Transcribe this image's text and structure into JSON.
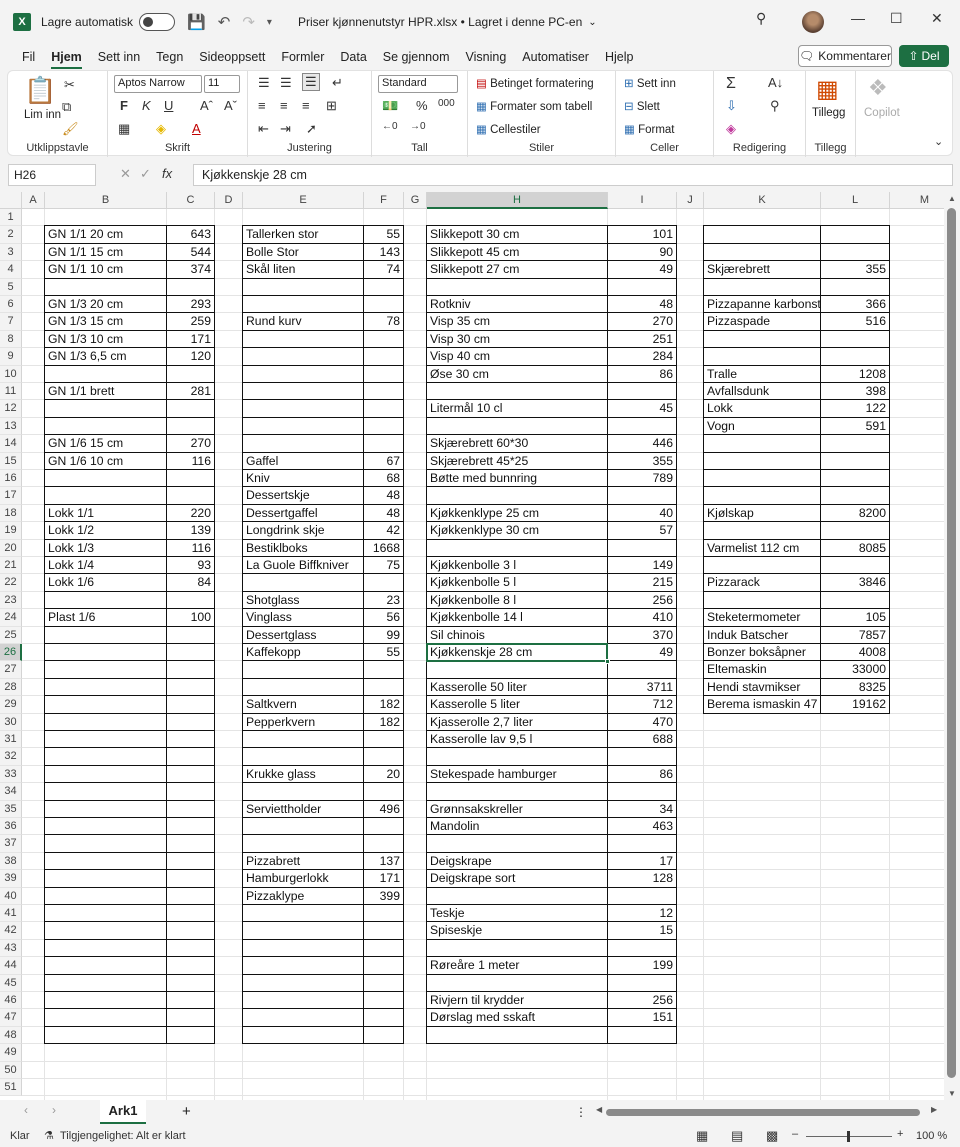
{
  "titlebar": {
    "autosave_label": "Lagre automatisk",
    "file_title": "Priser kjønnenutstyr HPR.xlsx • Lagret i denne PC-en"
  },
  "menu": [
    "Fil",
    "Hjem",
    "Sett inn",
    "Tegn",
    "Sideoppsett",
    "Formler",
    "Data",
    "Se gjennom",
    "Visning",
    "Automatiser",
    "Hjelp"
  ],
  "menu_active": "Hjem",
  "comment_button": "Kommentarer",
  "share_button": "Del",
  "ribbon": {
    "paste": "Lim inn",
    "clipboard": "Utklippstavle",
    "font_name": "Aptos Narrow",
    "font_size": "11",
    "font": "Skrift",
    "alignment": "Justering",
    "number_format": "Standard",
    "number": "Tall",
    "cond_format": "Betinget formatering",
    "format_table": "Formater som tabell",
    "cell_styles": "Cellestiler",
    "styles": "Stiler",
    "insert": "Sett inn",
    "delete": "Slett",
    "format": "Format",
    "cells": "Celler",
    "editing": "Redigering",
    "addins": "Tillegg",
    "addins_group": "Tillegg",
    "copilot": "Copilot"
  },
  "name_box": "H26",
  "formula": "Kjøkkenskje  28 cm",
  "columns": [
    "A",
    "B",
    "C",
    "D",
    "E",
    "F",
    "G",
    "H",
    "I",
    "J",
    "K",
    "L",
    "M"
  ],
  "rows": [
    "1",
    "2",
    "3",
    "4",
    "5",
    "6",
    "7",
    "8",
    "9",
    "10",
    "11",
    "12",
    "13",
    "14",
    "15",
    "16",
    "17",
    "18",
    "19",
    "20",
    "21",
    "22",
    "23",
    "24",
    "25",
    "26",
    "27",
    "28",
    "29",
    "30",
    "31",
    "32",
    "33",
    "34",
    "35",
    "36",
    "37",
    "38",
    "39",
    "40",
    "41",
    "42",
    "43",
    "44",
    "45",
    "46",
    "47",
    "48",
    "49",
    "50",
    "51"
  ],
  "cells": [
    {
      "r": 2,
      "c": "B",
      "v": "GN 1/1 20 cm"
    },
    {
      "r": 2,
      "c": "C",
      "v": "643"
    },
    {
      "r": 3,
      "c": "B",
      "v": "GN 1/1 15 cm"
    },
    {
      "r": 3,
      "c": "C",
      "v": "544"
    },
    {
      "r": 4,
      "c": "B",
      "v": "GN 1/1 10 cm"
    },
    {
      "r": 4,
      "c": "C",
      "v": "374"
    },
    {
      "r": 6,
      "c": "B",
      "v": "GN 1/3 20 cm"
    },
    {
      "r": 6,
      "c": "C",
      "v": "293"
    },
    {
      "r": 7,
      "c": "B",
      "v": "GN 1/3 15 cm"
    },
    {
      "r": 7,
      "c": "C",
      "v": "259"
    },
    {
      "r": 8,
      "c": "B",
      "v": "GN 1/3 10 cm"
    },
    {
      "r": 8,
      "c": "C",
      "v": "171"
    },
    {
      "r": 9,
      "c": "B",
      "v": "GN 1/3 6,5 cm"
    },
    {
      "r": 9,
      "c": "C",
      "v": "120"
    },
    {
      "r": 11,
      "c": "B",
      "v": "GN 1/1 brett"
    },
    {
      "r": 11,
      "c": "C",
      "v": "281"
    },
    {
      "r": 14,
      "c": "B",
      "v": "GN 1/6 15 cm"
    },
    {
      "r": 14,
      "c": "C",
      "v": "270"
    },
    {
      "r": 15,
      "c": "B",
      "v": "GN 1/6 10 cm"
    },
    {
      "r": 15,
      "c": "C",
      "v": "116"
    },
    {
      "r": 18,
      "c": "B",
      "v": "Lokk 1/1"
    },
    {
      "r": 18,
      "c": "C",
      "v": "220"
    },
    {
      "r": 19,
      "c": "B",
      "v": "Lokk 1/2"
    },
    {
      "r": 19,
      "c": "C",
      "v": "139"
    },
    {
      "r": 20,
      "c": "B",
      "v": "Lokk 1/3"
    },
    {
      "r": 20,
      "c": "C",
      "v": "116"
    },
    {
      "r": 21,
      "c": "B",
      "v": "Lokk 1/4"
    },
    {
      "r": 21,
      "c": "C",
      "v": "93"
    },
    {
      "r": 22,
      "c": "B",
      "v": "Lokk 1/6"
    },
    {
      "r": 22,
      "c": "C",
      "v": "84"
    },
    {
      "r": 24,
      "c": "B",
      "v": "Plast 1/6"
    },
    {
      "r": 24,
      "c": "C",
      "v": "100"
    },
    {
      "r": 2,
      "c": "E",
      "v": "Tallerken stor"
    },
    {
      "r": 2,
      "c": "F",
      "v": "55"
    },
    {
      "r": 3,
      "c": "E",
      "v": "Bolle Stor"
    },
    {
      "r": 3,
      "c": "F",
      "v": "143"
    },
    {
      "r": 4,
      "c": "E",
      "v": "Skål liten"
    },
    {
      "r": 4,
      "c": "F",
      "v": "74"
    },
    {
      "r": 7,
      "c": "E",
      "v": "Rund kurv"
    },
    {
      "r": 7,
      "c": "F",
      "v": "78"
    },
    {
      "r": 15,
      "c": "E",
      "v": "Gaffel"
    },
    {
      "r": 15,
      "c": "F",
      "v": "67"
    },
    {
      "r": 16,
      "c": "E",
      "v": "Kniv"
    },
    {
      "r": 16,
      "c": "F",
      "v": "68"
    },
    {
      "r": 17,
      "c": "E",
      "v": "Dessertskje"
    },
    {
      "r": 17,
      "c": "F",
      "v": "48"
    },
    {
      "r": 18,
      "c": "E",
      "v": "Dessertgaffel"
    },
    {
      "r": 18,
      "c": "F",
      "v": "48"
    },
    {
      "r": 19,
      "c": "E",
      "v": "Longdrink skje"
    },
    {
      "r": 19,
      "c": "F",
      "v": "42"
    },
    {
      "r": 20,
      "c": "E",
      "v": "Bestiklboks"
    },
    {
      "r": 20,
      "c": "F",
      "v": "1668"
    },
    {
      "r": 21,
      "c": "E",
      "v": "La Guole Biffkniver"
    },
    {
      "r": 21,
      "c": "F",
      "v": "75"
    },
    {
      "r": 23,
      "c": "E",
      "v": "Shotglass"
    },
    {
      "r": 23,
      "c": "F",
      "v": "23"
    },
    {
      "r": 24,
      "c": "E",
      "v": "Vinglass"
    },
    {
      "r": 24,
      "c": "F",
      "v": "56"
    },
    {
      "r": 25,
      "c": "E",
      "v": "Dessertglass"
    },
    {
      "r": 25,
      "c": "F",
      "v": "99"
    },
    {
      "r": 26,
      "c": "E",
      "v": "Kaffekopp"
    },
    {
      "r": 26,
      "c": "F",
      "v": "55"
    },
    {
      "r": 29,
      "c": "E",
      "v": "Saltkvern"
    },
    {
      "r": 29,
      "c": "F",
      "v": "182"
    },
    {
      "r": 30,
      "c": "E",
      "v": "Pepperkvern"
    },
    {
      "r": 30,
      "c": "F",
      "v": "182"
    },
    {
      "r": 33,
      "c": "E",
      "v": "Krukke glass"
    },
    {
      "r": 33,
      "c": "F",
      "v": "20"
    },
    {
      "r": 35,
      "c": "E",
      "v": "Serviettholder"
    },
    {
      "r": 35,
      "c": "F",
      "v": "496"
    },
    {
      "r": 38,
      "c": "E",
      "v": "Pizzabrett"
    },
    {
      "r": 38,
      "c": "F",
      "v": "137"
    },
    {
      "r": 39,
      "c": "E",
      "v": "Hamburgerlokk"
    },
    {
      "r": 39,
      "c": "F",
      "v": "171"
    },
    {
      "r": 40,
      "c": "E",
      "v": "Pizzaklype"
    },
    {
      "r": 40,
      "c": "F",
      "v": "399"
    },
    {
      "r": 2,
      "c": "H",
      "v": "Slikkepott 30 cm"
    },
    {
      "r": 2,
      "c": "I",
      "v": "101"
    },
    {
      "r": 3,
      "c": "H",
      "v": "Slikkepott 45 cm"
    },
    {
      "r": 3,
      "c": "I",
      "v": "90"
    },
    {
      "r": 4,
      "c": "H",
      "v": "Slikkepott 27 cm"
    },
    {
      "r": 4,
      "c": "I",
      "v": "49"
    },
    {
      "r": 6,
      "c": "H",
      "v": "Rotkniv"
    },
    {
      "r": 6,
      "c": "I",
      "v": "48"
    },
    {
      "r": 7,
      "c": "H",
      "v": "Visp 35 cm"
    },
    {
      "r": 7,
      "c": "I",
      "v": "270"
    },
    {
      "r": 8,
      "c": "H",
      "v": "Visp 30 cm"
    },
    {
      "r": 8,
      "c": "I",
      "v": "251"
    },
    {
      "r": 9,
      "c": "H",
      "v": "Visp 40 cm"
    },
    {
      "r": 9,
      "c": "I",
      "v": "284"
    },
    {
      "r": 10,
      "c": "H",
      "v": "Øse 30 cm"
    },
    {
      "r": 10,
      "c": "I",
      "v": "86"
    },
    {
      "r": 12,
      "c": "H",
      "v": "Litermål 10 cl"
    },
    {
      "r": 12,
      "c": "I",
      "v": "45"
    },
    {
      "r": 14,
      "c": "H",
      "v": "Skjærebrett 60*30"
    },
    {
      "r": 14,
      "c": "I",
      "v": "446"
    },
    {
      "r": 15,
      "c": "H",
      "v": "Skjærebrett 45*25"
    },
    {
      "r": 15,
      "c": "I",
      "v": "355"
    },
    {
      "r": 16,
      "c": "H",
      "v": "Bøtte med bunnring"
    },
    {
      "r": 16,
      "c": "I",
      "v": "789"
    },
    {
      "r": 18,
      "c": "H",
      "v": "Kjøkkenklype 25 cm"
    },
    {
      "r": 18,
      "c": "I",
      "v": "40"
    },
    {
      "r": 19,
      "c": "H",
      "v": "Kjøkkenklype 30 cm"
    },
    {
      "r": 19,
      "c": "I",
      "v": "57"
    },
    {
      "r": 21,
      "c": "H",
      "v": "Kjøkkenbolle 3 l"
    },
    {
      "r": 21,
      "c": "I",
      "v": "149"
    },
    {
      "r": 22,
      "c": "H",
      "v": "Kjøkkenbolle 5 l"
    },
    {
      "r": 22,
      "c": "I",
      "v": "215"
    },
    {
      "r": 23,
      "c": "H",
      "v": "Kjøkkenbolle 8 l"
    },
    {
      "r": 23,
      "c": "I",
      "v": "256"
    },
    {
      "r": 24,
      "c": "H",
      "v": "Kjøkkenbolle 14 l"
    },
    {
      "r": 24,
      "c": "I",
      "v": "410"
    },
    {
      "r": 25,
      "c": "H",
      "v": "Sil chinois"
    },
    {
      "r": 25,
      "c": "I",
      "v": "370"
    },
    {
      "r": 26,
      "c": "H",
      "v": "Kjøkkenskje  28 cm"
    },
    {
      "r": 26,
      "c": "I",
      "v": "49"
    },
    {
      "r": 28,
      "c": "H",
      "v": "Kasserolle 50 liter"
    },
    {
      "r": 28,
      "c": "I",
      "v": "3711"
    },
    {
      "r": 29,
      "c": "H",
      "v": "Kasserolle 5 liter"
    },
    {
      "r": 29,
      "c": "I",
      "v": "712"
    },
    {
      "r": 30,
      "c": "H",
      "v": "Kjasserolle  2,7 liter"
    },
    {
      "r": 30,
      "c": "I",
      "v": "470"
    },
    {
      "r": 31,
      "c": "H",
      "v": "Kasserolle lav  9,5 l"
    },
    {
      "r": 31,
      "c": "I",
      "v": "688"
    },
    {
      "r": 33,
      "c": "H",
      "v": "Stekespade hamburger"
    },
    {
      "r": 33,
      "c": "I",
      "v": "86"
    },
    {
      "r": 35,
      "c": "H",
      "v": "Grønnsakskreller"
    },
    {
      "r": 35,
      "c": "I",
      "v": "34"
    },
    {
      "r": 36,
      "c": "H",
      "v": "Mandolin"
    },
    {
      "r": 36,
      "c": "I",
      "v": "463"
    },
    {
      "r": 38,
      "c": "H",
      "v": "Deigskrape"
    },
    {
      "r": 38,
      "c": "I",
      "v": "17"
    },
    {
      "r": 39,
      "c": "H",
      "v": "Deigskrape sort"
    },
    {
      "r": 39,
      "c": "I",
      "v": "128"
    },
    {
      "r": 41,
      "c": "H",
      "v": "Teskje"
    },
    {
      "r": 41,
      "c": "I",
      "v": "12"
    },
    {
      "r": 42,
      "c": "H",
      "v": "Spiseskje"
    },
    {
      "r": 42,
      "c": "I",
      "v": "15"
    },
    {
      "r": 44,
      "c": "H",
      "v": "Røreåre 1 meter"
    },
    {
      "r": 44,
      "c": "I",
      "v": "199"
    },
    {
      "r": 46,
      "c": "H",
      "v": "Rivjern  til krydder"
    },
    {
      "r": 46,
      "c": "I",
      "v": "256"
    },
    {
      "r": 47,
      "c": "H",
      "v": "Dørslag med sskaft"
    },
    {
      "r": 47,
      "c": "I",
      "v": "151"
    },
    {
      "r": 4,
      "c": "K",
      "v": "Skjærebrett"
    },
    {
      "r": 4,
      "c": "L",
      "v": "355"
    },
    {
      "r": 6,
      "c": "K",
      "v": "Pizzapanne karbonstål"
    },
    {
      "r": 6,
      "c": "L",
      "v": "366"
    },
    {
      "r": 7,
      "c": "K",
      "v": "Pizzaspade"
    },
    {
      "r": 7,
      "c": "L",
      "v": "516"
    },
    {
      "r": 10,
      "c": "K",
      "v": "Tralle"
    },
    {
      "r": 10,
      "c": "L",
      "v": "1208"
    },
    {
      "r": 11,
      "c": "K",
      "v": "Avfallsdunk"
    },
    {
      "r": 11,
      "c": "L",
      "v": "398"
    },
    {
      "r": 12,
      "c": "K",
      "v": "Lokk"
    },
    {
      "r": 12,
      "c": "L",
      "v": "122"
    },
    {
      "r": 13,
      "c": "K",
      "v": "Vogn"
    },
    {
      "r": 13,
      "c": "L",
      "v": "591"
    },
    {
      "r": 18,
      "c": "K",
      "v": "Kjølskap"
    },
    {
      "r": 18,
      "c": "L",
      "v": "8200"
    },
    {
      "r": 20,
      "c": "K",
      "v": "Varmelist 112 cm"
    },
    {
      "r": 20,
      "c": "L",
      "v": "8085"
    },
    {
      "r": 22,
      "c": "K",
      "v": "Pizzarack"
    },
    {
      "r": 22,
      "c": "L",
      "v": "3846"
    },
    {
      "r": 24,
      "c": "K",
      "v": "Steketermometer"
    },
    {
      "r": 24,
      "c": "L",
      "v": "105"
    },
    {
      "r": 25,
      "c": "K",
      "v": "Induk Batscher"
    },
    {
      "r": 25,
      "c": "L",
      "v": "7857"
    },
    {
      "r": 26,
      "c": "K",
      "v": "Bonzer boksåpner"
    },
    {
      "r": 26,
      "c": "L",
      "v": "4008"
    },
    {
      "r": 27,
      "c": "K",
      "v": "Eltemaskin"
    },
    {
      "r": 27,
      "c": "L",
      "v": "33000"
    },
    {
      "r": 28,
      "c": "K",
      "v": "Hendi stavmikser"
    },
    {
      "r": 28,
      "c": "L",
      "v": "8325"
    },
    {
      "r": 29,
      "c": "K",
      "v": "Berema ismaskin  47"
    },
    {
      "r": 29,
      "c": "L",
      "v": "19162"
    }
  ],
  "selected_cell": {
    "r": 26,
    "c": "H"
  },
  "sheet_tab": "Ark1",
  "status": {
    "ready": "Klar",
    "accessibility": "Tilgjengelighet: Alt er klart",
    "zoom": "100 %"
  }
}
